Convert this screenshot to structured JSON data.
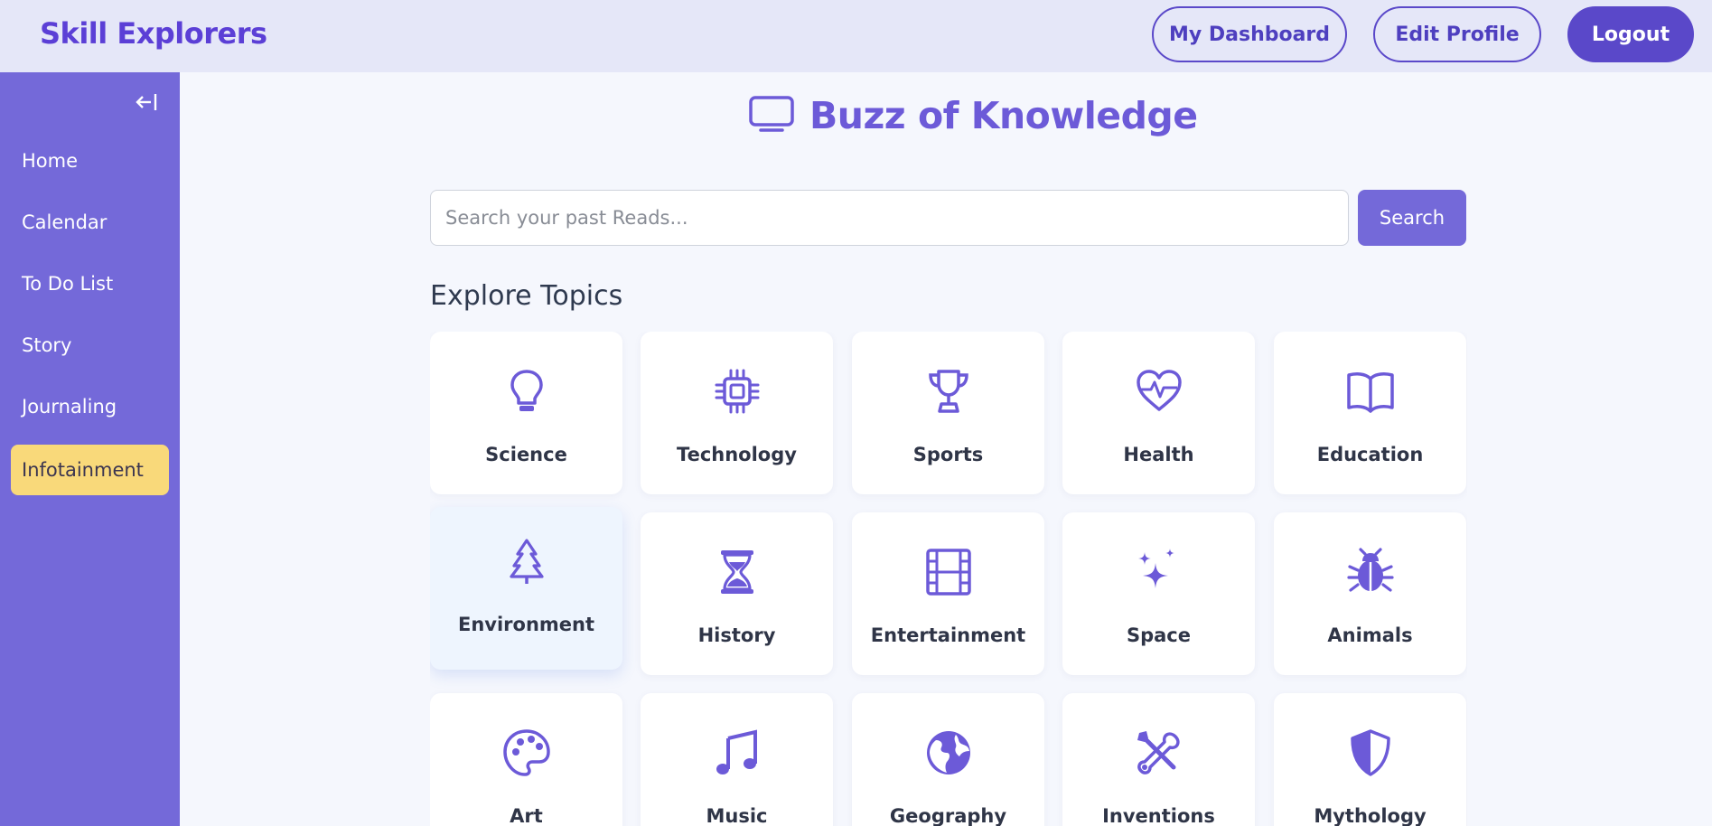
{
  "app": {
    "brand": "Skill Explorers"
  },
  "header": {
    "dashboard_label": "My Dashboard",
    "edit_profile_label": "Edit Profile",
    "logout_label": "Logout"
  },
  "sidebar": {
    "items": [
      {
        "label": "Home",
        "active": false
      },
      {
        "label": "Calendar",
        "active": false
      },
      {
        "label": "To Do List",
        "active": false
      },
      {
        "label": "Story",
        "active": false
      },
      {
        "label": "Journaling",
        "active": false
      },
      {
        "label": "Infotainment",
        "active": true
      }
    ]
  },
  "main": {
    "title": "Buzz of Knowledge",
    "title_icon": "monitor-icon",
    "search": {
      "placeholder": "Search your past Reads...",
      "value": "",
      "button_label": "Search"
    },
    "section_title": "Explore Topics",
    "topics": [
      {
        "label": "Science",
        "icon": "lightbulb-icon"
      },
      {
        "label": "Technology",
        "icon": "chip-icon"
      },
      {
        "label": "Sports",
        "icon": "trophy-icon"
      },
      {
        "label": "Health",
        "icon": "heart-pulse-icon"
      },
      {
        "label": "Education",
        "icon": "book-icon"
      },
      {
        "label": "Environment",
        "icon": "tree-icon"
      },
      {
        "label": "History",
        "icon": "hourglass-icon"
      },
      {
        "label": "Entertainment",
        "icon": "film-icon"
      },
      {
        "label": "Space",
        "icon": "sparkles-icon"
      },
      {
        "label": "Animals",
        "icon": "bug-icon"
      },
      {
        "label": "Art",
        "icon": "palette-icon"
      },
      {
        "label": "Music",
        "icon": "music-note-icon"
      },
      {
        "label": "Geography",
        "icon": "globe-icon"
      },
      {
        "label": "Inventions",
        "icon": "tools-icon"
      },
      {
        "label": "Mythology",
        "icon": "shield-icon"
      }
    ]
  },
  "colors": {
    "accent": "#7469d9",
    "brand": "#5b3fd6",
    "active_item": "#f9d97a",
    "header_bg": "#e5e7f8"
  }
}
